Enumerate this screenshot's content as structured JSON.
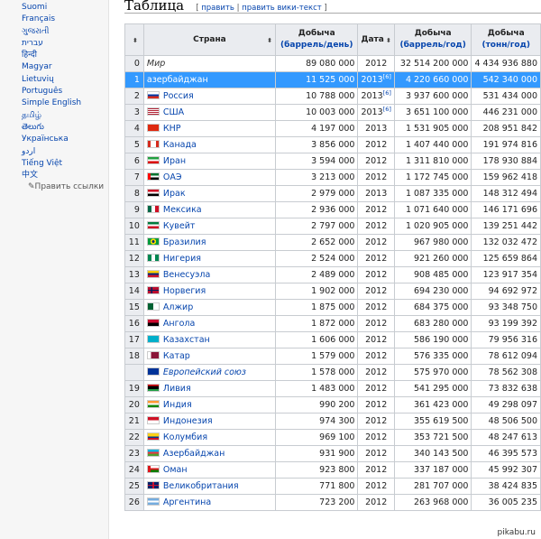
{
  "sidebar": {
    "languages": [
      "Suomi",
      "Français",
      "ગુજરાતી",
      "עברית",
      "हिन्दी",
      "Magyar",
      "Lietuvių",
      "Português",
      "Simple English",
      "தமிழ்",
      "తెలుగు",
      "Українська",
      "اردو",
      "Tiếng Việt",
      "中文"
    ],
    "edit_links": "Править ссылки"
  },
  "section": {
    "title": "Таблица",
    "bracket_open": "[",
    "edit": "править",
    "separator": "|",
    "edit_source": "править вики-текст",
    "bracket_close": "]"
  },
  "table": {
    "headers": {
      "rank": "",
      "country": "Страна",
      "prod_day": "Добыча",
      "prod_day_unit": "(баррель/день)",
      "date": "Дата",
      "prod_year": "Добыча",
      "prod_year_unit": "(баррель/год)",
      "prod_tons": "Добыча",
      "prod_tons_unit": "(тонн/год)"
    },
    "sort_glyph": "⬍",
    "rows": [
      {
        "rank": "0",
        "country": "Мир",
        "day": "89 080 000",
        "date": "2012",
        "sup": "",
        "year": "32 514 200 000",
        "tons": "4 434 936 880",
        "flag": "none"
      },
      {
        "rank": "1",
        "country": "азербайджан",
        "day": "11 525 000",
        "date": "2013",
        "sup": "[6]",
        "year": "4 220 660 000",
        "tons": "542 340 000",
        "flag": "none"
      },
      {
        "rank": "2",
        "country": "Россия",
        "day": "10 788 000",
        "date": "2013",
        "sup": "[6]",
        "year": "3 937 600 000",
        "tons": "531 434 000",
        "flag": "ru"
      },
      {
        "rank": "3",
        "country": "США",
        "day": "10 003 000",
        "date": "2013",
        "sup": "[6]",
        "year": "3 651 100 000",
        "tons": "446 231 000",
        "flag": "us"
      },
      {
        "rank": "4",
        "country": "КНР",
        "day": "4 197 000",
        "date": "2013",
        "sup": "",
        "year": "1 531 905 000",
        "tons": "208 951 842",
        "flag": "cn"
      },
      {
        "rank": "5",
        "country": "Канада",
        "day": "3 856 000",
        "date": "2012",
        "sup": "",
        "year": "1 407 440 000",
        "tons": "191 974 816",
        "flag": "ca"
      },
      {
        "rank": "6",
        "country": "Иран",
        "day": "3 594 000",
        "date": "2012",
        "sup": "",
        "year": "1 311 810 000",
        "tons": "178 930 884",
        "flag": "ir"
      },
      {
        "rank": "7",
        "country": "ОАЭ",
        "day": "3 213 000",
        "date": "2012",
        "sup": "",
        "year": "1 172 745 000",
        "tons": "159 962 418",
        "flag": "ae"
      },
      {
        "rank": "8",
        "country": "Ирак",
        "day": "2 979 000",
        "date": "2013",
        "sup": "",
        "year": "1 087 335 000",
        "tons": "148 312 494",
        "flag": "iq"
      },
      {
        "rank": "9",
        "country": "Мексика",
        "day": "2 936 000",
        "date": "2012",
        "sup": "",
        "year": "1 071 640 000",
        "tons": "146 171 696",
        "flag": "mx"
      },
      {
        "rank": "10",
        "country": "Кувейт",
        "day": "2 797 000",
        "date": "2012",
        "sup": "",
        "year": "1 020 905 000",
        "tons": "139 251 442",
        "flag": "kw"
      },
      {
        "rank": "11",
        "country": "Бразилия",
        "day": "2 652 000",
        "date": "2012",
        "sup": "",
        "year": "967 980 000",
        "tons": "132 032 472",
        "flag": "br"
      },
      {
        "rank": "12",
        "country": "Нигерия",
        "day": "2 524 000",
        "date": "2012",
        "sup": "",
        "year": "921 260 000",
        "tons": "125 659 864",
        "flag": "ng"
      },
      {
        "rank": "13",
        "country": "Венесуэла",
        "day": "2 489 000",
        "date": "2012",
        "sup": "",
        "year": "908 485 000",
        "tons": "123 917 354",
        "flag": "ve"
      },
      {
        "rank": "14",
        "country": "Норвегия",
        "day": "1 902 000",
        "date": "2012",
        "sup": "",
        "year": "694 230 000",
        "tons": "94 692 972",
        "flag": "no"
      },
      {
        "rank": "15",
        "country": "Алжир",
        "day": "1 875 000",
        "date": "2012",
        "sup": "",
        "year": "684 375 000",
        "tons": "93 348 750",
        "flag": "dz"
      },
      {
        "rank": "16",
        "country": "Ангола",
        "day": "1 872 000",
        "date": "2012",
        "sup": "",
        "year": "683 280 000",
        "tons": "93 199 392",
        "flag": "ao"
      },
      {
        "rank": "17",
        "country": "Казахстан",
        "day": "1 606 000",
        "date": "2012",
        "sup": "",
        "year": "586 190 000",
        "tons": "79 956 316",
        "flag": "kz"
      },
      {
        "rank": "18",
        "country": "Катар",
        "day": "1 579 000",
        "date": "2012",
        "sup": "",
        "year": "576 335 000",
        "tons": "78 612 094",
        "flag": "qa"
      },
      {
        "rank": "",
        "country": "Европейский союз",
        "day": "1 578 000",
        "date": "2012",
        "sup": "",
        "year": "575 970 000",
        "tons": "78 562 308",
        "flag": "eu"
      },
      {
        "rank": "19",
        "country": "Ливия",
        "day": "1 483 000",
        "date": "2012",
        "sup": "",
        "year": "541 295 000",
        "tons": "73 832 638",
        "flag": "ly"
      },
      {
        "rank": "20",
        "country": "Индия",
        "day": "990 200",
        "date": "2012",
        "sup": "",
        "year": "361 423 000",
        "tons": "49 298 097",
        "flag": "in"
      },
      {
        "rank": "21",
        "country": "Индонезия",
        "day": "974 300",
        "date": "2012",
        "sup": "",
        "year": "355 619 500",
        "tons": "48 506 500",
        "flag": "id"
      },
      {
        "rank": "22",
        "country": "Колумбия",
        "day": "969 100",
        "date": "2012",
        "sup": "",
        "year": "353 721 500",
        "tons": "48 247 613",
        "flag": "co"
      },
      {
        "rank": "23",
        "country": "Азербайджан",
        "day": "931 900",
        "date": "2012",
        "sup": "",
        "year": "340 143 500",
        "tons": "46 395 573",
        "flag": "az"
      },
      {
        "rank": "24",
        "country": "Оман",
        "day": "923 800",
        "date": "2012",
        "sup": "",
        "year": "337 187 000",
        "tons": "45 992 307",
        "flag": "om"
      },
      {
        "rank": "25",
        "country": "Великобритания",
        "day": "771 800",
        "date": "2012",
        "sup": "",
        "year": "281 707 000",
        "tons": "38 424 835",
        "flag": "gb"
      },
      {
        "rank": "26",
        "country": "Аргентина",
        "day": "723 200",
        "date": "2012",
        "sup": "",
        "year": "263 968 000",
        "tons": "36 005 235",
        "flag": "ar"
      }
    ]
  },
  "watermark": "pikabu.ru"
}
